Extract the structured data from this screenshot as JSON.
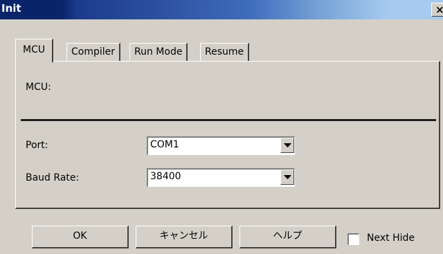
{
  "window": {
    "title": "Init",
    "close_glyph": "×"
  },
  "tabs": [
    {
      "label": "MCU",
      "active": true
    },
    {
      "label": "Compiler",
      "active": false
    },
    {
      "label": "Run Mode",
      "active": false
    },
    {
      "label": "Resume",
      "active": false
    }
  ],
  "mcu": {
    "label": "MCU:"
  },
  "port": {
    "label": "Port:",
    "value": "COM1"
  },
  "baud": {
    "label": "Baud Rate:",
    "value": "38400"
  },
  "buttons": {
    "ok": "OK",
    "cancel": "キャンセル",
    "help": "ヘルプ"
  },
  "next_hide": {
    "label": "Next Hide",
    "checked": false
  },
  "icons": {
    "dropdown": "chevron-down-icon",
    "close": "close-icon"
  }
}
